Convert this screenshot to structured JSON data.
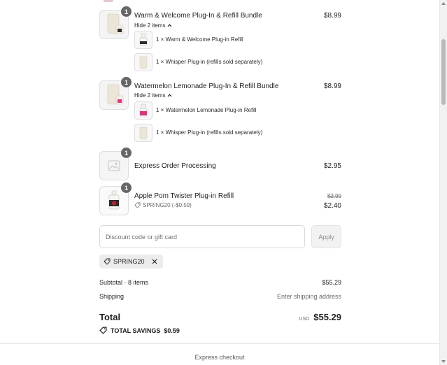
{
  "line_items": [
    {
      "title": "Warm & Welcome Plug-In & Refill Bundle",
      "price": "$8.99",
      "quantity": "1",
      "toggle_label": "Hide 2 items",
      "sub_items": [
        {
          "text": "1 × Warm & Welcome Plug-in Refill"
        },
        {
          "text": "1 × Whisper Plug-in (refills sold separately)"
        }
      ]
    },
    {
      "title": "Watermelon Lemonade Plug-In & Refill Bundle",
      "price": "$8.99",
      "quantity": "1",
      "toggle_label": "Hide 2 items",
      "sub_items": [
        {
          "text": "1 × Watermelon Lemonade Plug-in Refill"
        },
        {
          "text": "1 × Whisper Plug-in (refills sold separately)"
        }
      ]
    },
    {
      "title": "Express Order Processing",
      "price": "$2.95",
      "quantity": "1"
    },
    {
      "title": "Apple Pom Twister Plug-in Refill",
      "original_price": "$2.99",
      "price": "$2.40",
      "quantity": "1",
      "discount_label": "SPRING20 (-$0.59)"
    }
  ],
  "discount": {
    "placeholder": "Discount code or gift card",
    "apply_label": "Apply",
    "applied_code": "SPRING20"
  },
  "totals": {
    "subtotal_label": "Subtotal · 8 items",
    "subtotal_value": "$55.29",
    "shipping_label": "Shipping",
    "shipping_value": "Enter shipping address",
    "total_label": "Total",
    "currency": "USD",
    "total_value": "$55.29",
    "savings_label": "TOTAL SAVINGS",
    "savings_value": "$0.59"
  },
  "footer": {
    "express_checkout": "Express checkout"
  },
  "colors": {
    "badge": "#666666",
    "refill_pink": "#e0327a",
    "apple_red": "#c0202e",
    "plug_cream": "#ece6d8"
  }
}
